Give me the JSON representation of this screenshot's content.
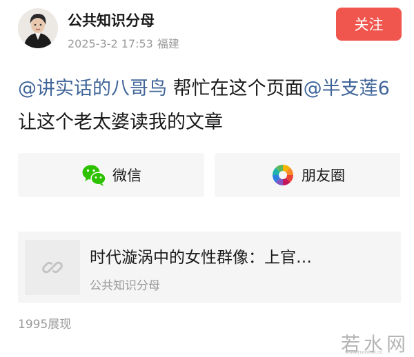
{
  "header": {
    "author_name": "公共知识分母",
    "post_datetime": "2025-3-2 17:53",
    "post_location": "福建",
    "follow_label": "关注"
  },
  "post": {
    "mention_1": "@讲实话的八哥鸟",
    "text_1": " 帮忙在这个页面",
    "mention_2": "@半支莲6",
    "text_2": " 让这个老太婆读我的文章"
  },
  "share": {
    "wechat_label": "微信",
    "moments_label": "朋友圈"
  },
  "link_card": {
    "title": "时代漩涡中的女性群像：上官…",
    "source": "公共知识分母"
  },
  "footer": {
    "impressions": "1995展现"
  },
  "watermark": {
    "text": "若水网",
    "url": "www.ruoshui.cc"
  },
  "colors": {
    "follow_button": "#f0564e",
    "mention_link": "#406599",
    "secondary_text": "#9a9a9a",
    "card_background": "#f5f5f5",
    "wechat_green": "#2dc100"
  },
  "icons": {
    "wechat": "wechat-icon",
    "moments": "moments-icon",
    "link": "link-icon"
  }
}
